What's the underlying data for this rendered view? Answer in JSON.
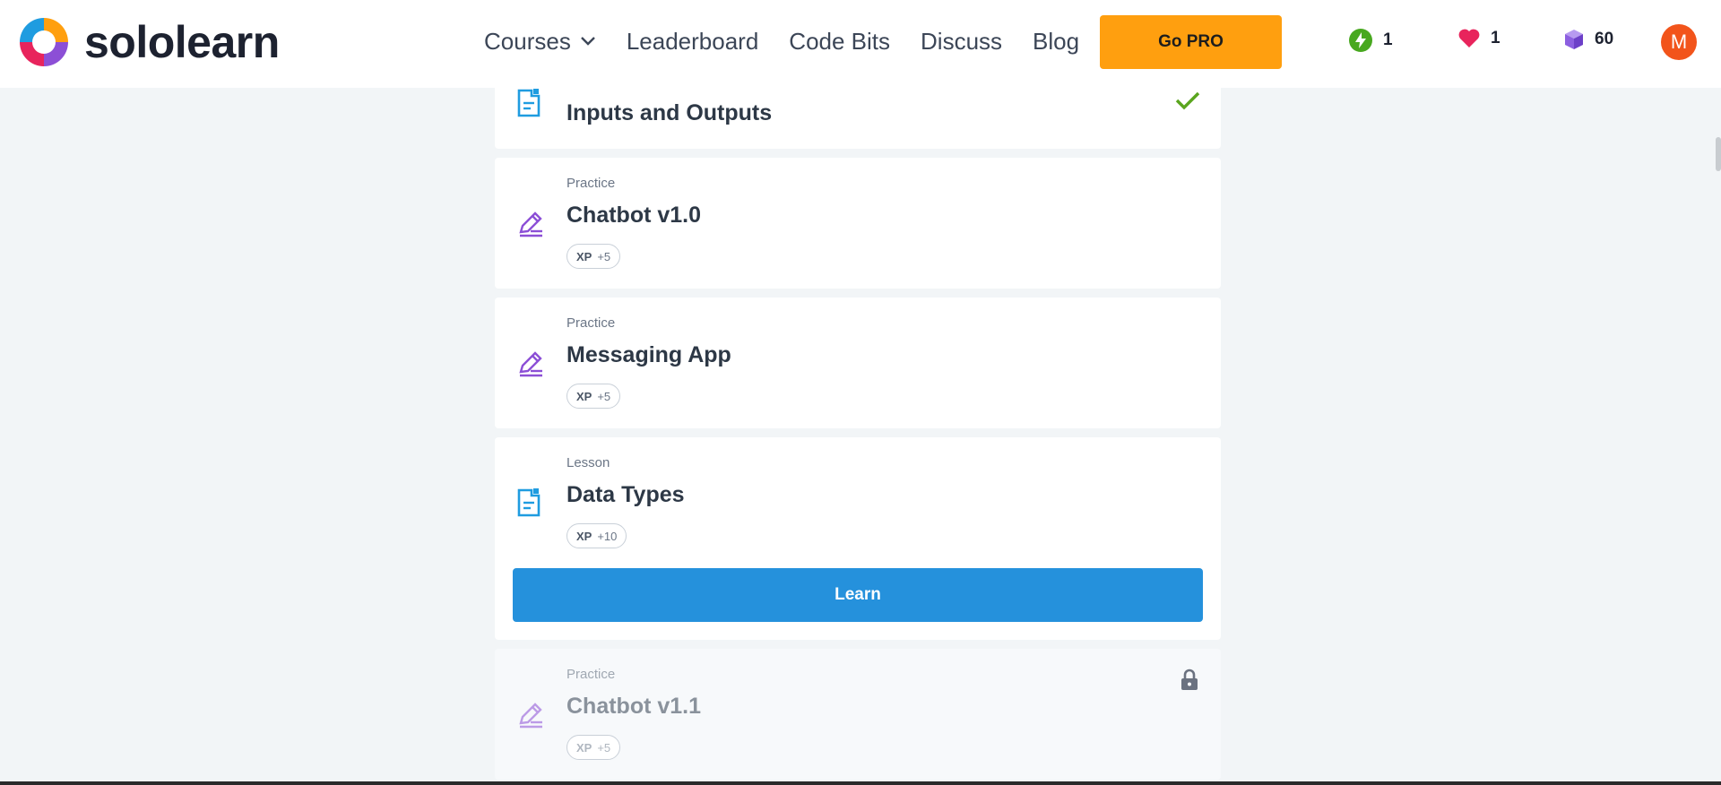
{
  "app": {
    "logo_text": "sololearn"
  },
  "nav": {
    "items": [
      {
        "label": "Courses",
        "has_dropdown": true
      },
      {
        "label": "Leaderboard"
      },
      {
        "label": "Code Bits"
      },
      {
        "label": "Discuss"
      },
      {
        "label": "Blog"
      }
    ],
    "cta": "Go PRO"
  },
  "stats": {
    "streak": "1",
    "hearts": "1",
    "bits": "60",
    "avatar_initial": "M"
  },
  "lessons": [
    {
      "kind": "",
      "title": "Inputs and Outputs",
      "status": "completed",
      "icon": "lesson-doc-icon"
    },
    {
      "kind": "Practice",
      "title": "Chatbot v1.0",
      "xp_label": "XP",
      "xp": "+5",
      "icon": "pencil-icon"
    },
    {
      "kind": "Practice",
      "title": "Messaging App",
      "xp_label": "XP",
      "xp": "+5",
      "icon": "pencil-icon"
    },
    {
      "kind": "Lesson",
      "title": "Data Types",
      "xp_label": "XP",
      "xp": "+10",
      "icon": "lesson-doc-icon",
      "action": "Learn"
    },
    {
      "kind": "Practice",
      "title": "Chatbot v1.1",
      "xp_label": "XP",
      "xp": "+5",
      "icon": "pencil-icon",
      "status": "locked"
    }
  ],
  "colors": {
    "accent_blue": "#2591dc",
    "pro_orange": "#ff9f0f",
    "check_green": "#5aa51e",
    "practice_purple": "#8c4fd6",
    "lesson_blue": "#1f9ce0"
  }
}
